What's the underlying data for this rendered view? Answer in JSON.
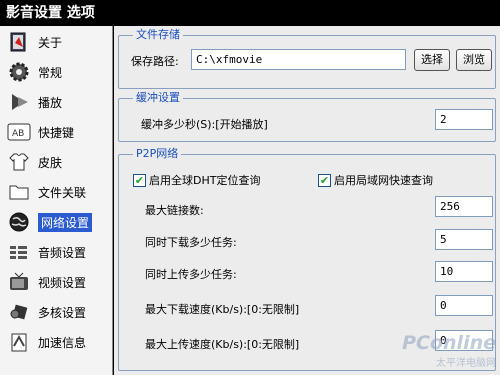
{
  "window": {
    "title": "影音设置 选项"
  },
  "sidebar": {
    "items": [
      {
        "label": "关于",
        "icon": "about-icon"
      },
      {
        "label": "常规",
        "icon": "gear-icon"
      },
      {
        "label": "播放",
        "icon": "play-icon"
      },
      {
        "label": "快捷键",
        "icon": "keyboard-icon"
      },
      {
        "label": "皮肤",
        "icon": "shirt-icon"
      },
      {
        "label": "文件关联",
        "icon": "folder-icon"
      },
      {
        "label": "网络设置",
        "icon": "globe-icon",
        "selected": true
      },
      {
        "label": "音频设置",
        "icon": "audio-icon"
      },
      {
        "label": "视频设置",
        "icon": "tv-icon"
      },
      {
        "label": "多核设置",
        "icon": "multicore-icon"
      },
      {
        "label": "加速信息",
        "icon": "accelerate-icon"
      }
    ]
  },
  "file_storage": {
    "title": "文件存储",
    "path_label": "保存路径:",
    "path_value": "C:\\xfmovie",
    "select_button": "选择",
    "browse_button": "浏览"
  },
  "buffer": {
    "title": "缓冲设置",
    "buffer_label": "缓冲多少秒(S):[开始播放]",
    "buffer_value": "2"
  },
  "p2p": {
    "title": "P2P网络",
    "dht_label": "启用全球DHT定位查询",
    "dht_checked": true,
    "lan_label": "启用局域网快速查询",
    "lan_checked": true,
    "max_links_label": "最大链接数:",
    "max_links_value": "256",
    "concurrent_download_label": "同时下载多少任务:",
    "concurrent_download_value": "5",
    "concurrent_upload_label": "同时上传多少任务:",
    "concurrent_upload_value": "10",
    "max_download_label": "最大下载速度(Kb/s):[0:无限制]",
    "max_download_value": "0",
    "max_upload_label": "最大上传速度(Kb/s):[0:无限制]",
    "max_upload_value": "0"
  },
  "watermark": {
    "logo": "PConline",
    "sub": "太平洋电脑网"
  }
}
